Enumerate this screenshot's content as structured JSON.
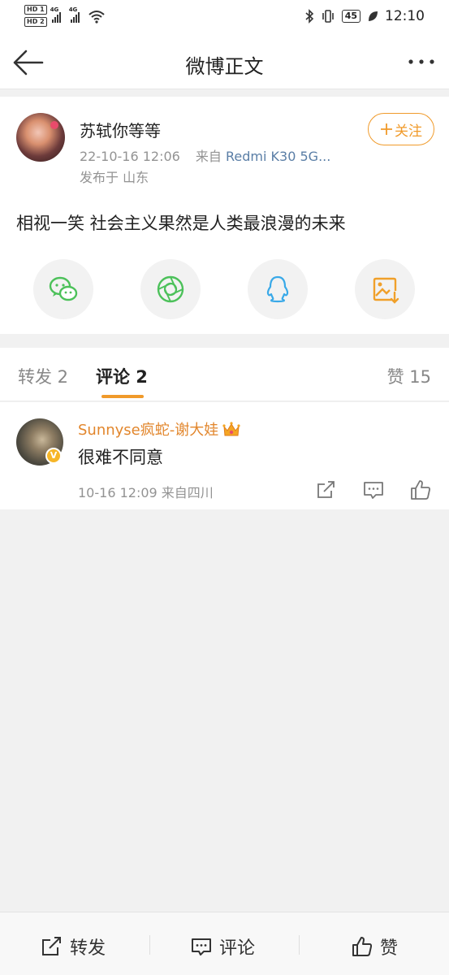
{
  "status_bar": {
    "sim1": "HD 1",
    "sim2": "HD 2",
    "network1": "4G",
    "network2": "4G",
    "battery": "45",
    "time": "12:10"
  },
  "nav": {
    "title": "微博正文"
  },
  "post": {
    "username": "苏轼你等等",
    "date": "22-10-16 12:06",
    "source_prefix": "来自",
    "device": "Redmi K30 5G...",
    "location": "发布于 山东",
    "follow_label": "关注",
    "text": "相视一笑 社会主义果然是人类最浪漫的未来"
  },
  "share": {
    "icons": [
      "wechat-icon",
      "moments-icon",
      "qq-icon",
      "save-image-icon"
    ]
  },
  "tabs": {
    "repost": "转发 2",
    "comment": "评论 2",
    "like": "赞 15"
  },
  "comments": [
    {
      "username": "Sunnyse疯蛇-谢大娃",
      "text": "很难不同意",
      "meta": "10-16 12:09  来自四川",
      "badge": "V"
    }
  ],
  "bottom_bar": {
    "repost": "转发",
    "comment": "评论",
    "like": "赞"
  },
  "colors": {
    "accent": "#f09a2a",
    "link_blue": "#5a7ea6",
    "meta_gray": "#939393",
    "comment_name": "#e2862c"
  }
}
